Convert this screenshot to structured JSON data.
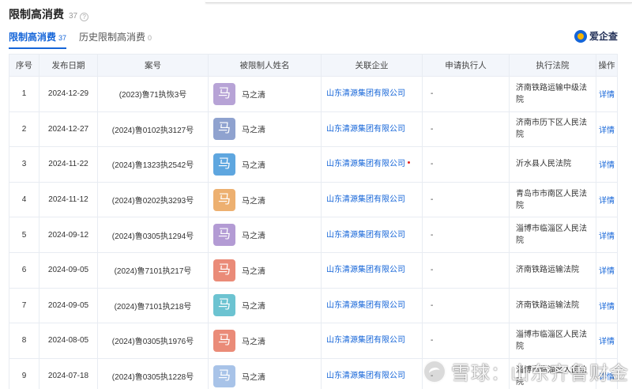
{
  "header": {
    "title": "限制高消费",
    "count": "37",
    "help": "?"
  },
  "tabs": [
    {
      "label": "限制高消费",
      "count": "37"
    },
    {
      "label": "历史限制高消费",
      "count": "0"
    }
  ],
  "brand": {
    "name": "爱企查"
  },
  "columns": [
    "序号",
    "发布日期",
    "案号",
    "被限制人姓名",
    "关联企业",
    "申请执行人",
    "执行法院",
    "操作"
  ],
  "rows": [
    {
      "no": "1",
      "date": "2024-12-29",
      "case": "(2023)鲁71执恢3号",
      "avatar": "马",
      "avatar_color": "#b7a3d6",
      "name": "马之清",
      "enterprise": "山东清源集团有限公司",
      "applicant": "-",
      "court": "济南铁路运输中级法院",
      "op": "详情"
    },
    {
      "no": "2",
      "date": "2024-12-27",
      "case": "(2024)鲁0102执3127号",
      "avatar": "马",
      "avatar_color": "#8fa2cf",
      "name": "马之清",
      "enterprise": "山东清源集团有限公司",
      "applicant": "-",
      "court": "济南市历下区人民法院",
      "op": "详情"
    },
    {
      "no": "3",
      "date": "2024-11-22",
      "case": "(2024)鲁1323执2542号",
      "avatar": "马",
      "avatar_color": "#5ea6df",
      "name": "马之清",
      "enterprise": "山东清源集团有限公司",
      "applicant": "-",
      "court": "沂水县人民法院",
      "op": "详情"
    },
    {
      "no": "4",
      "date": "2024-11-12",
      "case": "(2024)鲁0202执3293号",
      "avatar": "马",
      "avatar_color": "#edb070",
      "name": "马之清",
      "enterprise": "山东清源集团有限公司",
      "applicant": "-",
      "court": "青岛市市南区人民法院",
      "op": "详情"
    },
    {
      "no": "5",
      "date": "2024-09-12",
      "case": "(2024)鲁0305执1294号",
      "avatar": "马",
      "avatar_color": "#b39bd4",
      "name": "马之清",
      "enterprise": "山东清源集团有限公司",
      "applicant": "-",
      "court": "淄博市临淄区人民法院",
      "op": "详情"
    },
    {
      "no": "6",
      "date": "2024-09-05",
      "case": "(2024)鲁7101执217号",
      "avatar": "马",
      "avatar_color": "#ea8b78",
      "name": "马之清",
      "enterprise": "山东清源集团有限公司",
      "applicant": "-",
      "court": "济南铁路运输法院",
      "op": "详情"
    },
    {
      "no": "7",
      "date": "2024-09-05",
      "case": "(2024)鲁7101执218号",
      "avatar": "马",
      "avatar_color": "#6cc3d1",
      "name": "马之清",
      "enterprise": "山东清源集团有限公司",
      "applicant": "-",
      "court": "济南铁路运输法院",
      "op": "详情"
    },
    {
      "no": "8",
      "date": "2024-08-05",
      "case": "(2024)鲁0305执1976号",
      "avatar": "马",
      "avatar_color": "#ea8b78",
      "name": "马之清",
      "enterprise": "山东清源集团有限公司",
      "applicant": "-",
      "court": "淄博市临淄区人民法院",
      "op": "详情"
    },
    {
      "no": "9",
      "date": "2024-07-18",
      "case": "(2024)鲁0305执1228号",
      "avatar": "马",
      "avatar_color": "#a8c3e8",
      "name": "马之清",
      "enterprise": "山东清源集团有限公司",
      "applicant": "-",
      "court": "淄博市临淄区人民法院",
      "op": "详情"
    }
  ],
  "watermark": {
    "text": "雪球：山东齐鲁财金"
  },
  "colors": {
    "accent": "#1565d8",
    "header_bg": "#f3f6fb",
    "border": "#e8ecf2"
  }
}
